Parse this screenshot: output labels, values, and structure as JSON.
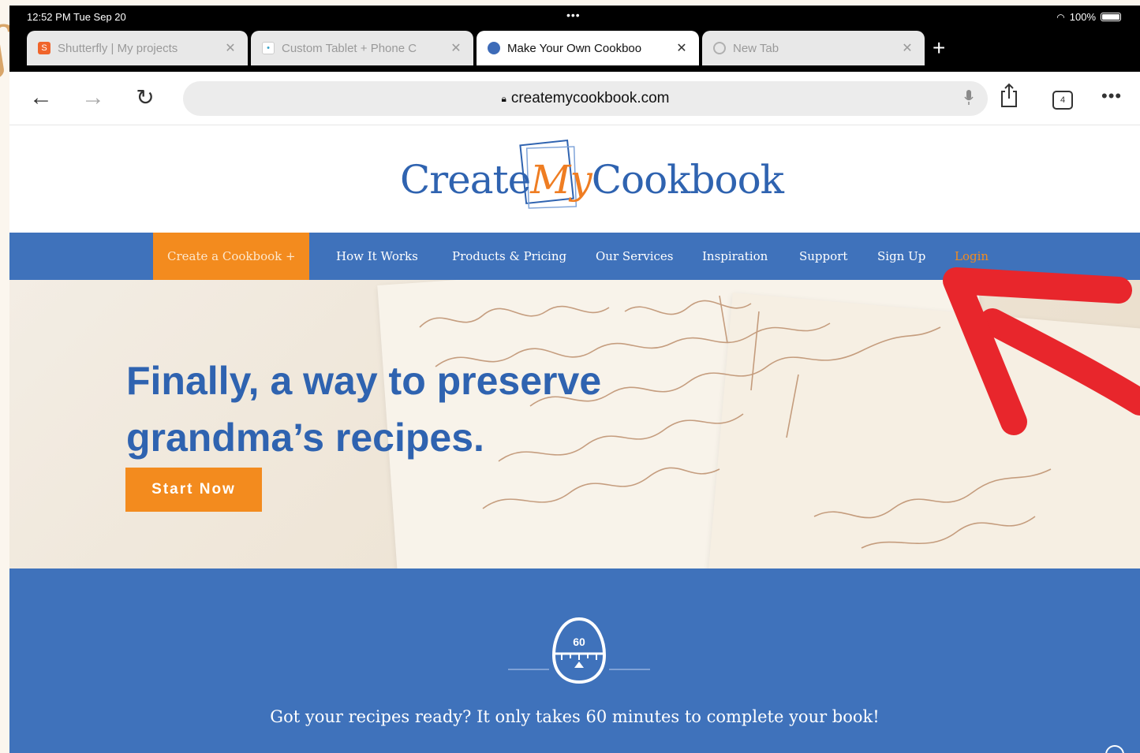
{
  "status_bar": {
    "time": "12:52 PM  Tue Sep 20",
    "dots": "•••",
    "battery": "100%"
  },
  "tabs": [
    {
      "title": "Shutterfly | My projects",
      "favicon_color": "#f0642a",
      "favicon_glyph": "S",
      "active": false
    },
    {
      "title": "Custom Tablet + Phone C",
      "favicon_color": "#3aa3c8",
      "favicon_glyph": "•",
      "active": false
    },
    {
      "title": "Make Your Own Cookboo",
      "favicon_color": "#3d6bb8",
      "favicon_glyph": "",
      "active": true
    },
    {
      "title": "New Tab",
      "favicon_color": "#b0b0b0",
      "favicon_glyph": "",
      "active": false
    }
  ],
  "address_bar": {
    "url": "createmycookbook.com",
    "tab_count": "4",
    "more": "•••"
  },
  "site": {
    "logo": {
      "create": "Create",
      "my": "My",
      "cookbook": "Cookbook"
    },
    "nav": [
      {
        "label": "Create a Cookbook +",
        "type": "cta"
      },
      {
        "label": "How It Works"
      },
      {
        "label": "Products & Pricing"
      },
      {
        "label": "Our Services"
      },
      {
        "label": "Inspiration"
      },
      {
        "label": "Support"
      },
      {
        "label": "Sign Up"
      },
      {
        "label": "Login",
        "type": "login"
      }
    ],
    "hero": {
      "title_line1": "Finally, a way to preserve",
      "title_line2": "grandma’s recipes.",
      "button": "Start Now"
    },
    "band": {
      "timer_label": "60",
      "text": "Got your recipes ready? It only takes 60 minutes to complete your book!"
    }
  },
  "colors": {
    "brand_blue": "#3f72bb",
    "brand_orange": "#f38b1e",
    "annotation_red": "#e8262c"
  },
  "icons": [
    "back-arrow-icon",
    "forward-arrow-icon",
    "reload-icon",
    "lock-icon",
    "microphone-icon",
    "share-icon",
    "tabs-icon",
    "more-icon",
    "plus-icon",
    "close-icon",
    "timer-icon",
    "red-arrow-annotation"
  ]
}
